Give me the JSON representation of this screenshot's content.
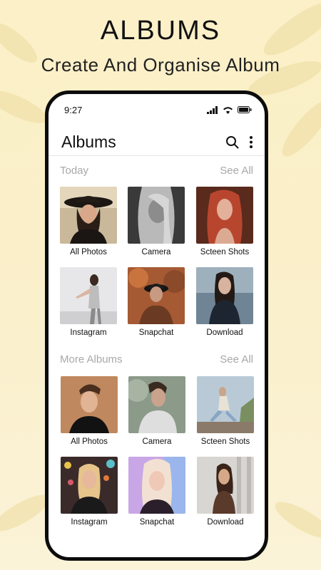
{
  "promo": {
    "title": "ALBUMS",
    "subtitle": "Create And Organise Album"
  },
  "status_bar": {
    "time": "9:27",
    "icons": [
      "signal-icon",
      "wifi-icon",
      "battery-icon"
    ]
  },
  "header": {
    "title": "Albums",
    "actions": [
      "search-icon",
      "more-vertical-icon"
    ]
  },
  "sections": [
    {
      "title": "Today",
      "see_all": "See All",
      "albums": [
        {
          "label": "All Photos"
        },
        {
          "label": "Camera"
        },
        {
          "label": "Scteen Shots"
        },
        {
          "label": "Instagram"
        },
        {
          "label": "Snapchat"
        },
        {
          "label": "Download"
        }
      ]
    },
    {
      "title": "More Albums",
      "see_all": "See All",
      "albums": [
        {
          "label": "All Photos"
        },
        {
          "label": "Camera"
        },
        {
          "label": "Scteen Shots"
        },
        {
          "label": "Instagram"
        },
        {
          "label": "Snapchat"
        },
        {
          "label": "Download"
        }
      ]
    }
  ],
  "colors": {
    "background": "#fbf0c8",
    "phone_frame": "#0c0c0c",
    "section_header": "#a8a8a8",
    "text": "#111111"
  }
}
